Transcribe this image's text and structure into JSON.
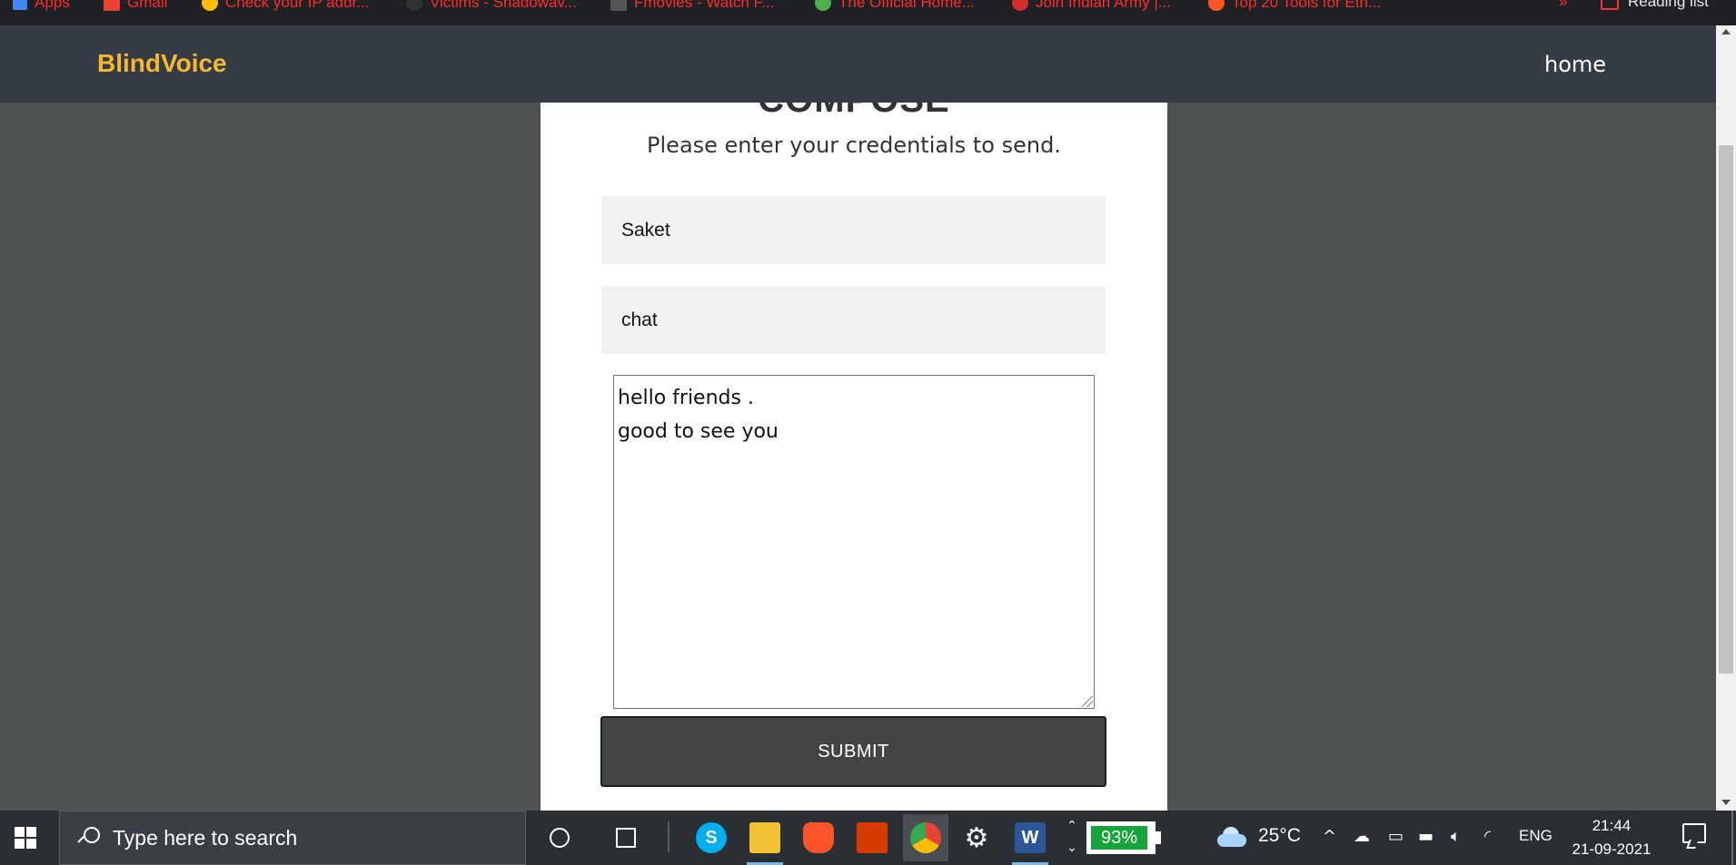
{
  "browser": {
    "bookmarks": [
      {
        "label": "Apps",
        "color": "#4285f4"
      },
      {
        "label": "Gmail",
        "color": "#ea4335"
      },
      {
        "label": "Check your IP addr...",
        "color": "#fbbc05"
      },
      {
        "label": "Victims - Shadowav...",
        "color": "#888888"
      },
      {
        "label": "Fmovies - Watch F...",
        "color": "#555555"
      },
      {
        "label": "The Official Home...",
        "color": "#4caf50"
      },
      {
        "label": "Join Indian Army |...",
        "color": "#d32f2f"
      },
      {
        "label": "Top 20 Tools for Eth...",
        "color": "#ff5722"
      }
    ],
    "more_label": "»",
    "reading_list_label": "Reading list"
  },
  "navbar": {
    "brand": "BlindVoice",
    "home_link": "home",
    "brand_color": "#f5b82e"
  },
  "compose": {
    "title": "COMPOSE",
    "subtitle": "Please enter your credentials to send.",
    "recipient_value": "Saket",
    "subject_value": "chat",
    "message_value": "hello friends .\ngood to see you",
    "submit_label": "SUBMIT"
  },
  "taskbar": {
    "search_placeholder": "Type here to search",
    "apps": [
      "skype-icon",
      "file-explorer-icon",
      "brave-icon",
      "office-icon",
      "chrome-icon",
      "settings-icon",
      "word-icon"
    ],
    "battery_percent": "93%",
    "temperature": "25°C",
    "language": "ENG",
    "time": "21:44",
    "date": "21-09-2021"
  }
}
